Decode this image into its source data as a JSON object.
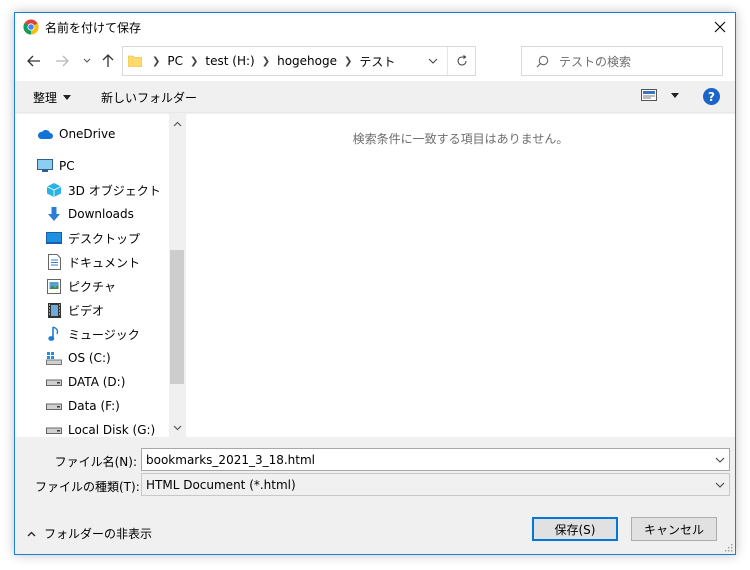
{
  "window": {
    "title": "名前を付けて保存"
  },
  "address": {
    "crumbs": [
      "PC",
      "test (H:)",
      "hogehoge",
      "テスト"
    ]
  },
  "search": {
    "placeholder": "テストの検索"
  },
  "toolbar": {
    "organize_label": "整理",
    "new_folder_label": "新しいフォルダー"
  },
  "nav_tree": {
    "onedrive": "OneDrive",
    "pc": "PC",
    "objects3d": "3D オブジェクト",
    "downloads": "Downloads",
    "desktop": "デスクトップ",
    "documents": "ドキュメント",
    "pictures": "ピクチャ",
    "videos": "ビデオ",
    "music": "ミュージック",
    "os_c": "OS (C:)",
    "data_d": "DATA (D:)",
    "data_f": "Data (F:)",
    "local_g": "Local Disk (G:)"
  },
  "content": {
    "empty_message": "検索条件に一致する項目はありません。"
  },
  "fields": {
    "filename_label": "ファイル名(N):",
    "filename_value": "bookmarks_2021_3_18.html",
    "filetype_label": "ファイルの種類(T):",
    "filetype_value": "HTML Document (*.html)"
  },
  "footer": {
    "hide_folders_label": "フォルダーの非表示",
    "save_label": "保存(S)",
    "cancel_label": "キャンセル"
  },
  "colors": {
    "accent": "#0078d7",
    "help": "#1c64c8",
    "folder": "#ffd96b"
  }
}
